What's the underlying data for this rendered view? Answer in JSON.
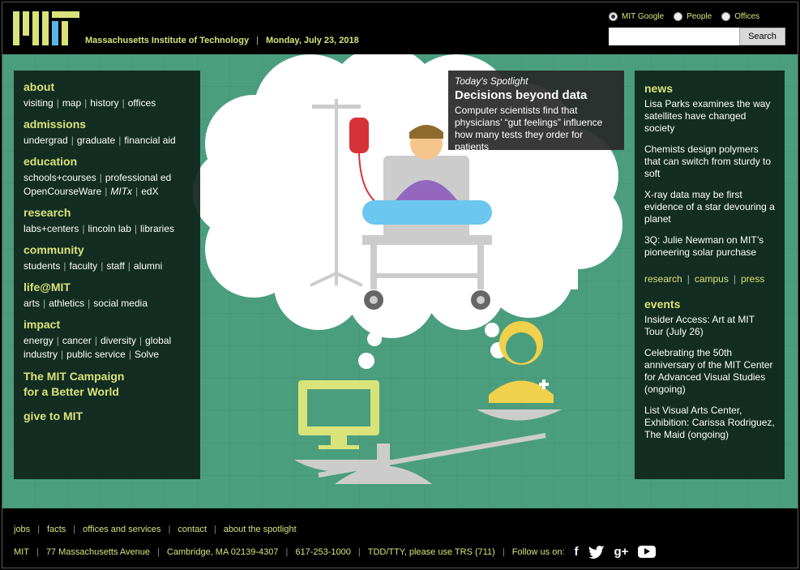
{
  "header": {
    "org_name": "Massachusetts Institute of Technology",
    "date": "Monday, July 23, 2018",
    "search_options": [
      {
        "label": "MIT Google",
        "selected": true
      },
      {
        "label": "People",
        "selected": false
      },
      {
        "label": "Offices",
        "selected": false
      }
    ],
    "search_value": "",
    "search_button": "Search",
    "logo_icon": "mit-logo-icon"
  },
  "nav": {
    "sections": [
      {
        "title": "about",
        "links": [
          "visiting",
          "map",
          "history",
          "offices"
        ]
      },
      {
        "title": "admissions",
        "links": [
          "undergrad",
          "graduate",
          "financial aid"
        ]
      },
      {
        "title": "education",
        "links": [
          "schools+courses",
          "professional ed"
        ],
        "links2": [
          "OpenCourseWare",
          "MITx",
          "edX"
        ]
      },
      {
        "title": "research",
        "links": [
          "labs+centers",
          "lincoln lab",
          "libraries"
        ]
      },
      {
        "title": "community",
        "links": [
          "students",
          "faculty",
          "staff",
          "alumni"
        ]
      },
      {
        "title": "life@MIT",
        "links": [
          "arts",
          "athletics",
          "social media"
        ]
      },
      {
        "title": "impact",
        "links": [
          "energy",
          "cancer",
          "diversity",
          "global"
        ],
        "links2": [
          "industry",
          "public service",
          "Solve"
        ]
      }
    ],
    "campaign_line1": "The MIT Campaign",
    "campaign_line2": "for a Better World",
    "give": "give to MIT"
  },
  "spotlight": {
    "kicker": "Today's Spotlight",
    "title": "Decisions beyond data",
    "description": "Computer scientists find that physicians’ “gut feelings” influence how many tests they order for patients"
  },
  "news": {
    "title": "news",
    "items": [
      "Lisa Parks examines the way satellites have changed society",
      "Chemists design polymers that can switch from sturdy to soft",
      "X-ray data may be first evidence of a star devouring a planet",
      "3Q: Julie Newman on MIT’s pioneering solar purchase"
    ],
    "links": [
      "research",
      "campus",
      "press"
    ]
  },
  "events": {
    "title": "events",
    "items": [
      "Insider Access: Art at MIT Tour (July 26)",
      "Celebrating the 50th anniversary of the MIT Center for Advanced Visual Studies (ongoing)",
      "List Visual Arts Center, Exhibition: Carissa Rodriguez, The Maid (ongoing)"
    ]
  },
  "footer": {
    "row1": [
      "jobs",
      "facts",
      "offices and services",
      "contact",
      "about the spotlight"
    ],
    "row2": [
      "MIT",
      "77 Massachusetts Avenue",
      "Cambridge, MA 02139-4307",
      "617-253-1000",
      "TDD/TTY, please use TRS (711)"
    ],
    "follow": "Follow us on:",
    "social_icons": [
      "facebook-icon",
      "twitter-icon",
      "google-plus-icon",
      "youtube-icon"
    ]
  },
  "colors": {
    "accent": "#d9e37a",
    "background": "#4a9e7e",
    "panel": "#0e241a"
  }
}
